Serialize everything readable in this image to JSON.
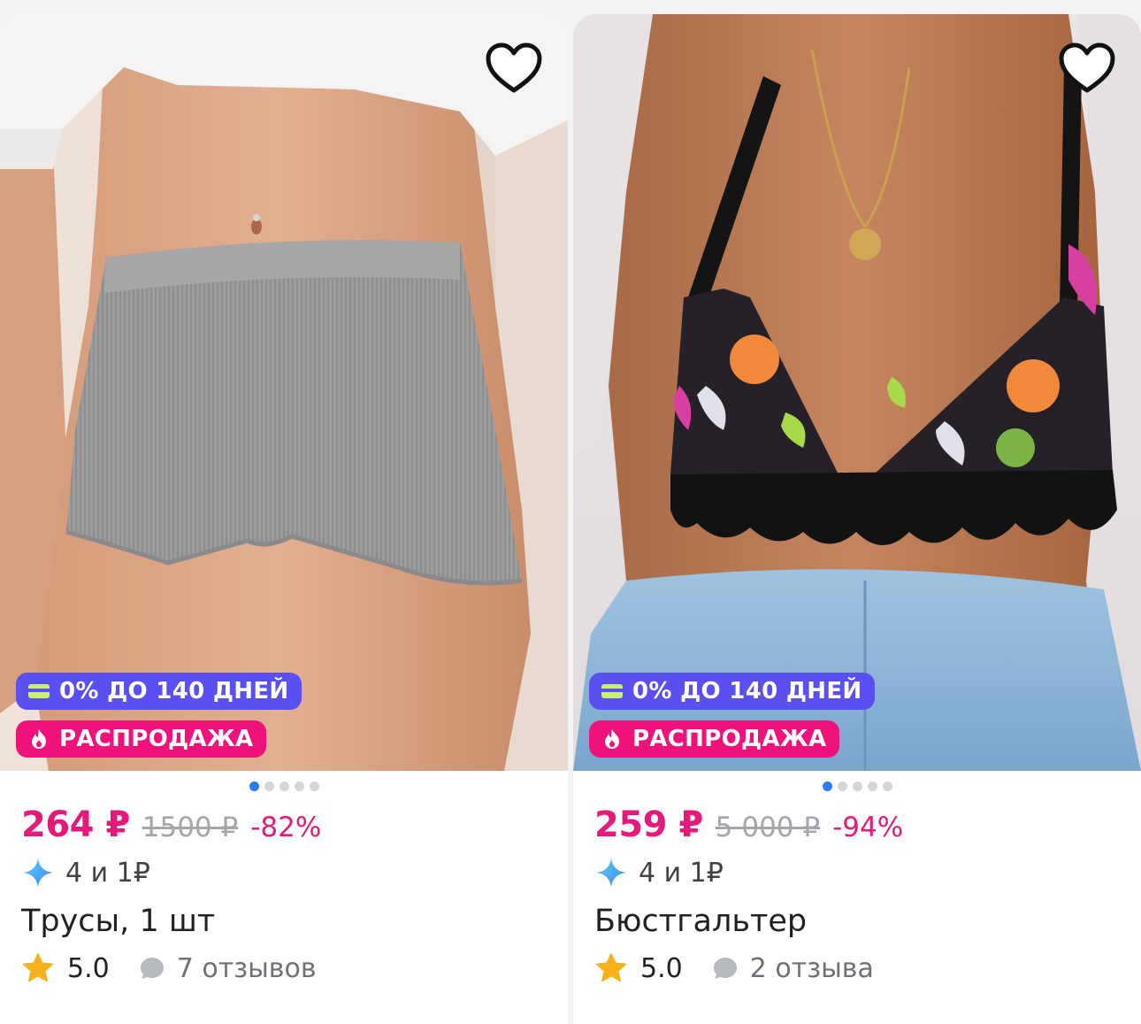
{
  "products": [
    {
      "badge_credit": "0% ДО 140 ДНЕЙ",
      "badge_sale": "РАСПРОДАЖА",
      "price": "264 ₽",
      "old_price": "1500 ₽",
      "discount": "-82%",
      "points": "4 и 1₽",
      "title": "Трусы, 1 шт",
      "rating": "5.0",
      "reviews": "7 отзывов",
      "carousel_dots": 5,
      "carousel_active": 1
    },
    {
      "badge_credit": "0% ДО 140 ДНЕЙ",
      "badge_sale": "РАСПРОДАЖА",
      "price": "259 ₽",
      "old_price": "5 000 ₽",
      "discount": "-94%",
      "points": "4 и 1₽",
      "title": "Бюстгальтер",
      "rating": "5.0",
      "reviews": "2 отзыва",
      "carousel_dots": 5,
      "carousel_active": 1
    }
  ],
  "icons": {
    "favorite": "heart-outline-icon",
    "credit": "card-icon",
    "sale": "fire-icon",
    "points": "sparkle-icon",
    "rating": "star-icon",
    "reviews": "chat-bubble-icon"
  },
  "colors": {
    "price": "#e5197a",
    "credit_badge": "#5a4ff0",
    "sale_badge": "#f0127b",
    "active_dot": "#2b7bf2",
    "star": "#f7b21b"
  }
}
